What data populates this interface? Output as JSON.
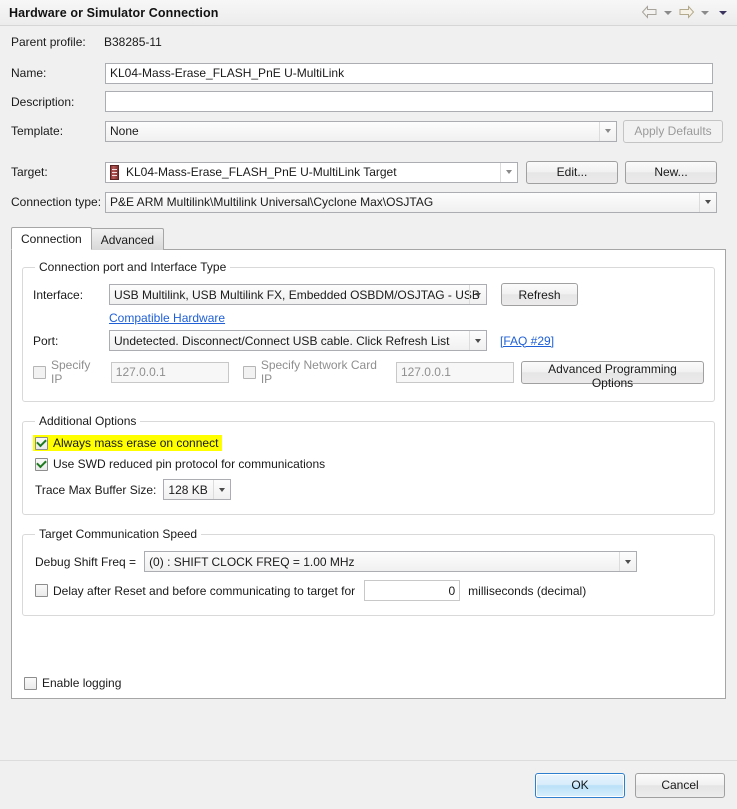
{
  "window": {
    "title": "Hardware or Simulator Connection",
    "nav": {
      "back_icon": "back-arrow-icon",
      "back_dropdown_icon": "chevron-down-icon",
      "forward_icon": "forward-arrow-icon",
      "forward_dropdown_icon": "chevron-down-icon",
      "menu_icon": "chevron-down-icon"
    }
  },
  "parent_profile": {
    "label": "Parent profile:",
    "value": "B38285-11"
  },
  "form": {
    "name": {
      "label": "Name:",
      "value": "KL04-Mass-Erase_FLASH_PnE U-MultiLink"
    },
    "description": {
      "label": "Description:",
      "value": "",
      "placeholder": ""
    },
    "template": {
      "label": "Template:",
      "value": "None",
      "apply_defaults_label": "Apply Defaults"
    },
    "target": {
      "label": "Target:",
      "value": "KL04-Mass-Erase_FLASH_PnE U-MultiLink Target",
      "icon": "device-chip-icon",
      "edit_label": "Edit...",
      "new_label": "New..."
    },
    "connection_type": {
      "label": "Connection type:",
      "value": "P&E ARM Multilink\\Multilink Universal\\Cyclone Max\\OSJTAG"
    }
  },
  "tabs": [
    {
      "label": "Connection",
      "active": true
    },
    {
      "label": "Advanced",
      "active": false
    }
  ],
  "connection_tab": {
    "port_group": {
      "legend": "Connection port and Interface Type",
      "interface": {
        "label": "Interface:",
        "value": "USB Multilink, USB Multilink FX, Embedded OSBDM/OSJTAG - USB",
        "refresh_label": "Refresh"
      },
      "compatible_hardware_link": "Compatible Hardware",
      "port": {
        "label": "Port:",
        "value": "Undetected. Disconnect/Connect USB cable. Click Refresh List",
        "faq_link": "[FAQ #29]"
      },
      "specify_ip": {
        "label": "Specify IP",
        "checked": false,
        "enabled": false,
        "value": "127.0.0.1"
      },
      "specify_network_card_ip": {
        "label": "Specify Network Card IP",
        "checked": false,
        "enabled": false,
        "value": "127.0.0.1"
      },
      "advanced_programming_options_label": "Advanced Programming Options"
    },
    "additional_options": {
      "legend": "Additional Options",
      "mass_erase": {
        "label": "Always mass erase on connect",
        "checked": true,
        "highlighted": true,
        "highlight_color": "#ffff00"
      },
      "swd_protocol": {
        "label": "Use SWD reduced pin protocol for communications",
        "checked": true
      },
      "trace_buffer": {
        "label": "Trace Max Buffer Size:",
        "value": "128 KB"
      }
    },
    "target_speed": {
      "legend": "Target Communication Speed",
      "debug_shift_freq": {
        "label": "Debug Shift Freq =",
        "value": "(0) : SHIFT CLOCK FREQ = 1.00 MHz"
      },
      "delay": {
        "label": "Delay after Reset and before communicating to target for",
        "checked": false,
        "value": "0",
        "units": "milliseconds (decimal)"
      }
    },
    "enable_logging": {
      "label": "Enable logging",
      "checked": false
    }
  },
  "footer": {
    "ok_label": "OK",
    "cancel_label": "Cancel"
  },
  "colors": {
    "accent": "#1f5fd6",
    "highlight": "#ffff00",
    "check": "#1f7a1f",
    "window_bg": "#f0f0f0"
  }
}
